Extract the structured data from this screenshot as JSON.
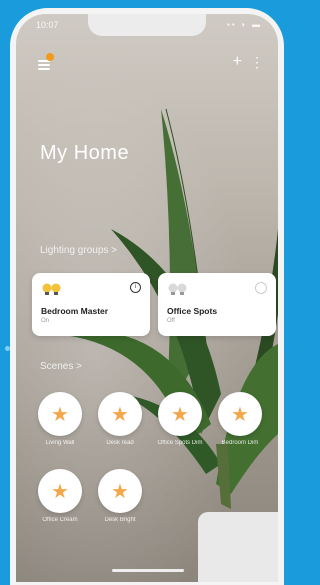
{
  "status_bar": {
    "time": "10:07",
    "icons": "▪▪ ◗ ▬"
  },
  "header": {
    "menu_icon": "menu-icon",
    "add_icon": "plus-icon",
    "more_icon": "more-icon"
  },
  "home": {
    "title": "My Home"
  },
  "lighting": {
    "label": "Lighting groups >",
    "groups": [
      {
        "name": "Bedroom Master",
        "state": "On",
        "icon": "bulb-icon-on"
      },
      {
        "name": "Office Spots",
        "state": "Off",
        "icon": "bulb-icon-off"
      }
    ]
  },
  "scenes": {
    "label": "Scenes >",
    "items": [
      {
        "label": "Living Wall",
        "icon": "star-icon"
      },
      {
        "label": "Desk read",
        "icon": "star-icon"
      },
      {
        "label": "Office Spots Dim",
        "icon": "star-icon"
      },
      {
        "label": "Bedroom Dim",
        "icon": "star-icon"
      },
      {
        "label": "Office Cream",
        "icon": "star-icon"
      },
      {
        "label": "Desk Bright",
        "icon": "star-icon"
      }
    ]
  },
  "colors": {
    "background": "#1a9bdc",
    "accent": "#f29a1f",
    "star": "#f2a84a"
  }
}
